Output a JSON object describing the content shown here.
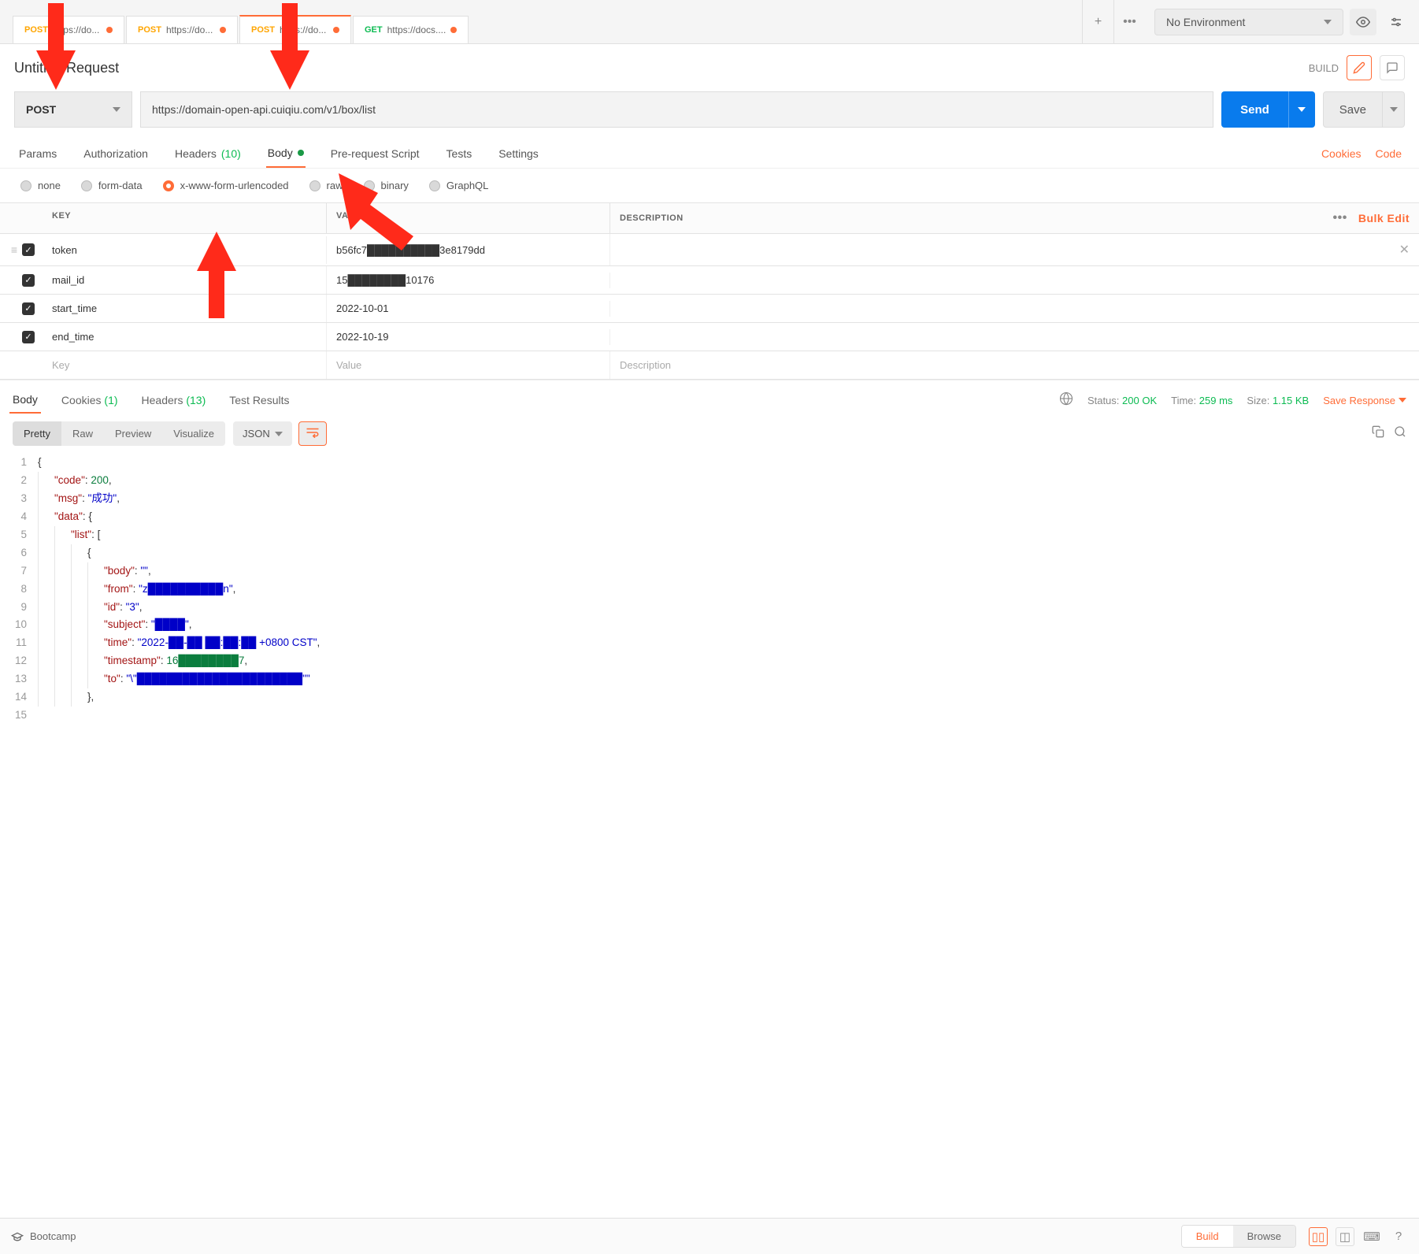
{
  "env": {
    "label": "No Environment"
  },
  "tabs": [
    {
      "method": "POST",
      "methodClass": "method-post",
      "text": "https://do...",
      "dot": true,
      "active": false
    },
    {
      "method": "POST",
      "methodClass": "method-post",
      "text": "https://do...",
      "dot": true,
      "active": false
    },
    {
      "method": "POST",
      "methodClass": "method-post",
      "text": "https://do...",
      "dot": true,
      "active": true
    },
    {
      "method": "GET",
      "methodClass": "method-get",
      "text": "https://docs....",
      "dot": true,
      "active": false
    }
  ],
  "request": {
    "title": "Untitled Request",
    "build": "BUILD",
    "method": "POST",
    "url": "https://domain-open-api.cuiqiu.com/v1/box/list",
    "send": "Send",
    "save": "Save"
  },
  "reqTabs": {
    "params": "Params",
    "auth": "Authorization",
    "headers": "Headers",
    "headersCount": "(10)",
    "body": "Body",
    "prereq": "Pre-request Script",
    "tests": "Tests",
    "settings": "Settings",
    "cookies": "Cookies",
    "code": "Code"
  },
  "bodyTypes": {
    "none": "none",
    "form": "form-data",
    "urlenc": "x-www-form-urlencoded",
    "raw": "raw",
    "binary": "binary",
    "graphql": "GraphQL"
  },
  "kv": {
    "headers": {
      "key": "KEY",
      "value": "VALUE",
      "desc": "DESCRIPTION",
      "bulk": "Bulk Edit"
    },
    "rows": [
      {
        "key": "token",
        "value": "b56fc7██████████3e8179dd"
      },
      {
        "key": "mail_id",
        "value": "15████████10176"
      },
      {
        "key": "start_time",
        "value": "2022-10-01"
      },
      {
        "key": "end_time",
        "value": "2022-10-19"
      }
    ],
    "placeholders": {
      "key": "Key",
      "value": "Value",
      "desc": "Description"
    }
  },
  "respTabs": {
    "body": "Body",
    "cookies": "Cookies",
    "cookiesCount": "(1)",
    "headers": "Headers",
    "headersCount": "(13)",
    "test": "Test Results"
  },
  "respStatus": {
    "statusLabel": "Status:",
    "status": "200 OK",
    "timeLabel": "Time:",
    "time": "259 ms",
    "sizeLabel": "Size:",
    "size": "1.15 KB",
    "save": "Save Response"
  },
  "viewer": {
    "pretty": "Pretty",
    "raw": "Raw",
    "preview": "Preview",
    "visualize": "Visualize",
    "format": "JSON"
  },
  "responseBody": {
    "code": 200,
    "msg": "成功",
    "list": [
      {
        "body": "",
        "from": "z██████████n",
        "id": "3",
        "subject": "████",
        "time": "2022-██-██ ██:██:██ +0800 CST",
        "timestamp": "16████████7",
        "to": "\\\"██████████████████████\""
      }
    ]
  },
  "footer": {
    "bootcamp": "Bootcamp",
    "build": "Build",
    "browse": "Browse"
  }
}
